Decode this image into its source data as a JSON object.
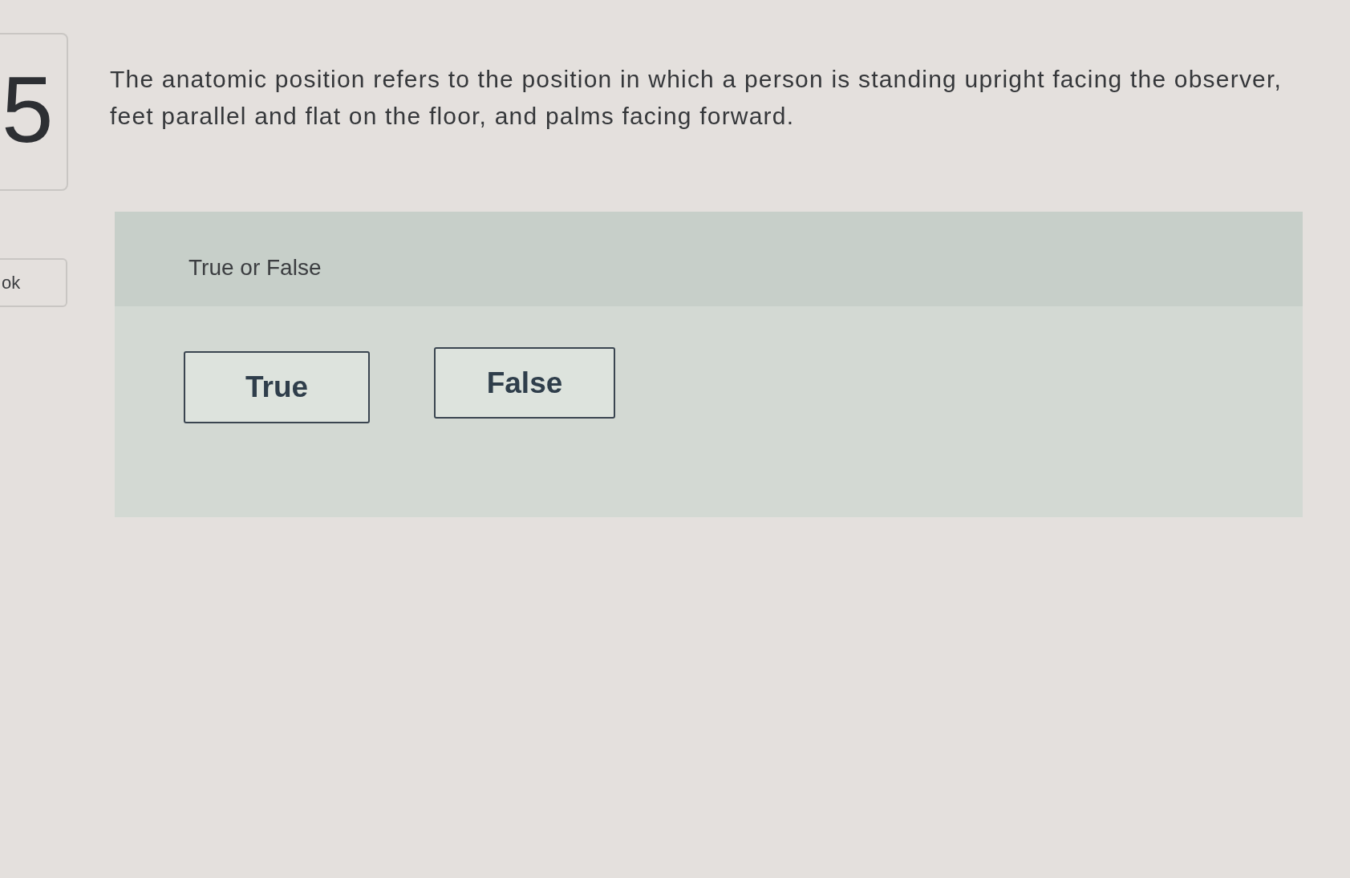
{
  "question_number": "5",
  "sidebar_button": "ok",
  "question": "The anatomic position refers to the position in which a person is standing upright facing the observer, feet parallel and flat on the floor, and palms facing forward.",
  "answer_panel": {
    "title": "True or False",
    "options": [
      {
        "label": "True",
        "selected": false
      },
      {
        "label": "False",
        "selected": false
      }
    ]
  }
}
